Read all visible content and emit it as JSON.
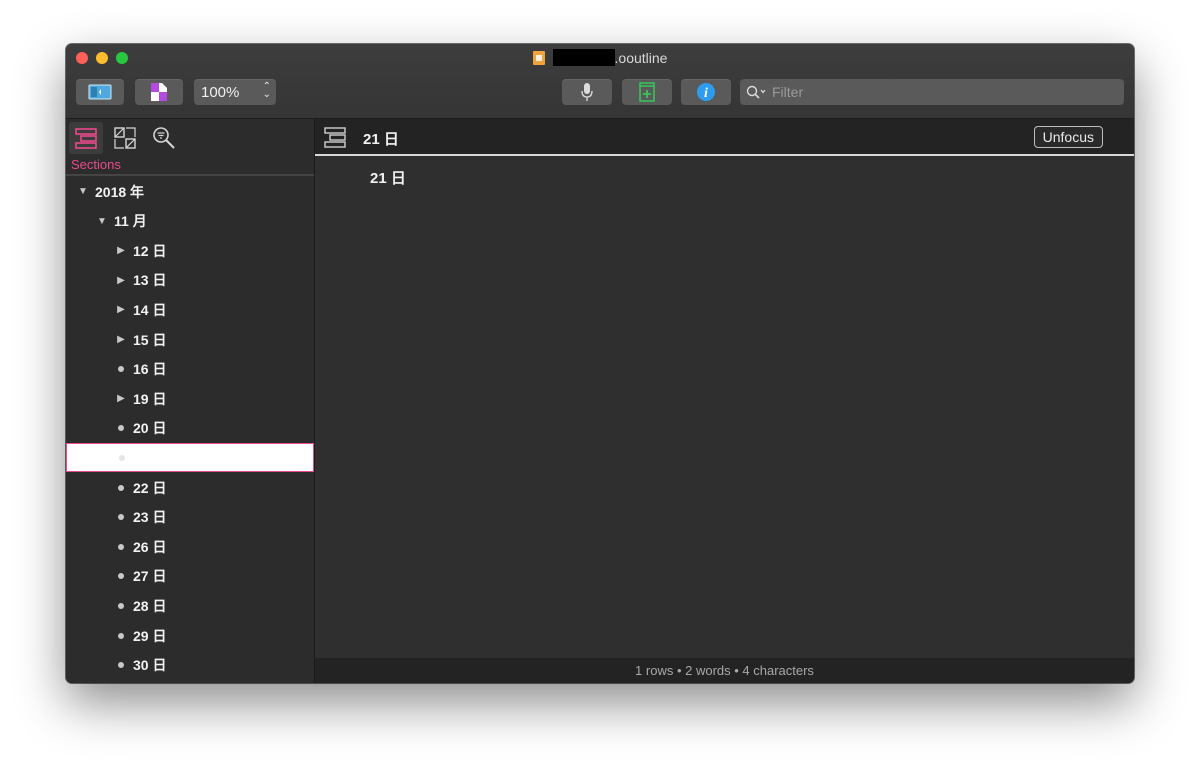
{
  "window": {
    "title_suffix": ".ooutline"
  },
  "toolbar": {
    "zoom_value": "100%",
    "filter_placeholder": "Filter"
  },
  "sidebar": {
    "sections_label": "Sections",
    "tree": [
      {
        "label": "2018 年",
        "marker": "expanded",
        "level": 0
      },
      {
        "label": "11 月",
        "marker": "expanded",
        "level": 1
      },
      {
        "label": "12 日",
        "marker": "collapsed",
        "level": 2
      },
      {
        "label": "13 日",
        "marker": "collapsed",
        "level": 2
      },
      {
        "label": "14 日",
        "marker": "collapsed",
        "level": 2
      },
      {
        "label": "15 日",
        "marker": "collapsed",
        "level": 2
      },
      {
        "label": "16 日",
        "marker": "bullet",
        "level": 2
      },
      {
        "label": "19 日",
        "marker": "collapsed",
        "level": 2
      },
      {
        "label": "20 日",
        "marker": "bullet",
        "level": 2
      },
      {
        "label": "",
        "marker": "bullet",
        "level": 2,
        "selected": true
      },
      {
        "label": "22 日",
        "marker": "bullet",
        "level": 2
      },
      {
        "label": "23 日",
        "marker": "bullet",
        "level": 2
      },
      {
        "label": "26 日",
        "marker": "bullet",
        "level": 2
      },
      {
        "label": "27 日",
        "marker": "bullet",
        "level": 2
      },
      {
        "label": "28 日",
        "marker": "bullet",
        "level": 2
      },
      {
        "label": "29 日",
        "marker": "bullet",
        "level": 2
      },
      {
        "label": "30 日",
        "marker": "bullet",
        "level": 2
      }
    ]
  },
  "main": {
    "focus_title": "21 日",
    "unfocus_label": "Unfocus",
    "content_text": "21 日",
    "status": "1 rows • 2 words • 4 characters"
  },
  "colors": {
    "accent": "#e84a8c",
    "window_bg": "#2f2f2f",
    "info_blue": "#2d9cf0",
    "add_green": "#34c759"
  }
}
